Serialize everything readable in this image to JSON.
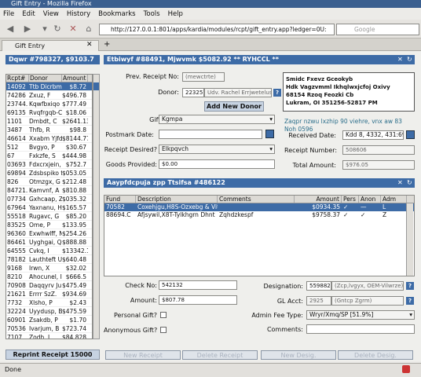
{
  "window": {
    "title": "Gift Entry - Mozilla Firefox"
  },
  "menu": [
    "File",
    "Edit",
    "View",
    "History",
    "Bookmarks",
    "Tools",
    "Help"
  ],
  "url": "http://127.0.0.1:801/apps/kardia/modules/rcpt/gift_entry.app?ledger=0U:",
  "search_placeholder": "Google",
  "tab": {
    "label": "Gift Entry"
  },
  "left_header": "Dqwr #798327, $9103.7",
  "center_header": "Etbiwyf #88491, Mjwvmk $5082.92 ** RYHCCL **",
  "receipts": {
    "columns": [
      "Rcpt#",
      "Donor",
      "Amount"
    ],
    "rows": [
      [
        "14092",
        "Ttb Dicrbm",
        "$8.72"
      ],
      [
        "74286",
        "Zxuz, F",
        "$496.78"
      ],
      [
        "23744.",
        "Kqwfbxiqo",
        "$777.49"
      ],
      [
        "69135",
        "Rvqfrgqb-C",
        "$18.06"
      ],
      [
        "1101",
        "Dmbdt, C",
        "$2641.13"
      ],
      [
        "3487",
        "Thfb, R",
        "$98.8"
      ],
      [
        "46614",
        "Xxabm Yjfd",
        "$8144.77"
      ],
      [
        "512",
        "Bvgyo, P",
        "$30.67"
      ],
      [
        "67",
        "Fxkzfe, S",
        "$444.98"
      ],
      [
        "03693",
        "Fdxcrxjein,",
        "$752.7"
      ],
      [
        "69894",
        "Zdsbspiko f",
        "$053.05"
      ],
      [
        "826",
        "Otmzgx, G",
        "$212.48"
      ],
      [
        "84721.",
        "Kamvnf, A",
        "$810.88"
      ],
      [
        "07734",
        "Gxhcaap, Z",
        "$035.32"
      ],
      [
        "67964",
        "Yaxnanu, H",
        "$165.57"
      ],
      [
        "55518",
        "Rugavc, G",
        "$85.20"
      ],
      [
        "83525",
        "Ome, P",
        "$133.95"
      ],
      [
        "96360",
        "Exwhwlff, N",
        "$254.26"
      ],
      [
        "86461",
        "Uyghgai, Q",
        "$888.88"
      ],
      [
        "64555",
        "Cvkq, I",
        "$13342.1"
      ],
      [
        "78182",
        "Lauthteft U",
        "$640.48"
      ],
      [
        "9168",
        "Irwn, X",
        "$32.02"
      ],
      [
        "8210",
        "Ahocunel, I",
        "$666.5"
      ],
      [
        "70908",
        "Daqqyrv Ju",
        "$475.49"
      ],
      [
        "21621",
        "Errrr SzZ.",
        "$934.69"
      ],
      [
        "7732",
        "Xlsho, P",
        "$2.43"
      ],
      [
        "32224",
        "Uyydusp, B",
        "$475.59"
      ],
      [
        "60901",
        "Zsakdb, P",
        "$1.70"
      ],
      [
        "70536",
        "Ivarjum, B",
        "$723.74"
      ],
      [
        "7107",
        "Zodh, L",
        "$84.828"
      ],
      [
        "7371",
        "Qufielrfm, N",
        "$815.92"
      ]
    ]
  },
  "reprint_button": "Reprint Receipt 15000",
  "form": {
    "prev_receipt_label": "Prev. Receipt No:",
    "prev_receipt_value": "(mewctrte)",
    "donor_label": "Donor:",
    "donor_id": "223257",
    "donor_name": "Udv. Rachel Errjwetelusn Zu",
    "add_donor_button": "Add New Donor",
    "gift_type_label": "Gift Type:",
    "gift_type_value": "Kgmpa",
    "postmark_label": "Postmark Date:",
    "postmark_value": "",
    "receipt_desired_label": "Receipt Desired?",
    "receipt_desired_value": "Elkpqvch",
    "goods_label": "Goods Provided:",
    "goods_value": "$0.00",
    "address_lines": [
      "Smidc Fxevz Gceokyb",
      "Hdk Vagzvmml Ikhqlwxjcfoj Oxivy",
      "68154 Rzoq Feozki Cb",
      "Lukram, OI 351256-52817 PM"
    ],
    "donor_note": "Zaqpr nzwu lxzhip 90 viehre, vnx aw 83 Noh 0596",
    "received_label": "Received Date:",
    "received_value": "Kdd 8, 4332, 431:69",
    "receipt_number_label": "Receipt Number:",
    "receipt_number_value": "508606",
    "total_label": "Total Amount:",
    "total_value": "$976.05"
  },
  "items_header": "Aaypfdcpuja zpp Ttsifsa #486122",
  "items": {
    "columns": [
      "Fund",
      "Description",
      "Comments",
      "Amount",
      "Pers",
      "Anon",
      "Adm"
    ],
    "rows": [
      {
        "fund": "70582",
        "desc": "Coxehjgu,H8S-Ozxebg & Vitk",
        "comments": "",
        "amount": "$0934.35",
        "pers": "✓",
        "anon": "—",
        "adm": "L"
      },
      {
        "fund": "88694.C",
        "desc": "Afjsywil,X8T-Tylkhgrn Dhnt",
        "comments": "Zqhdzkespf",
        "amount": "$9758.37",
        "pers": "✓",
        "anon": "✓",
        "adm": "Z"
      }
    ]
  },
  "detail": {
    "check_label": "Check No:",
    "check_value": "542132",
    "amount_label": "Amount:",
    "amount_value": "$807.78",
    "personal_label": "Personal Gift?",
    "anonymous_label": "Anonymous Gift?",
    "designation_label": "Designation:",
    "designation_id": "5598824",
    "designation_name": "(Zcp,lvgyx, OEM-Vilwrze) w",
    "gl_label": "GL Acct:",
    "gl_value": "2925",
    "gl_name": "(Gntcp Zgrm)",
    "admin_fee_label": "Admin Fee Type:",
    "admin_fee_value": "Wryr/Xmq/SP [51.9%]",
    "comments_label": "Comments:",
    "comments_value": ""
  },
  "bottom_buttons": [
    "New Receipt",
    "Delete Receipt",
    "New Desig.",
    "Delete Desig."
  ],
  "status": "Done"
}
